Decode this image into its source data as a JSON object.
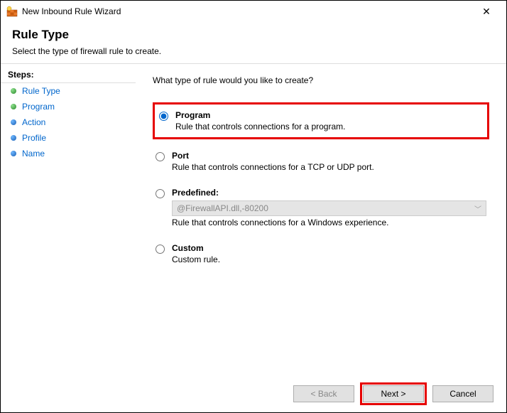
{
  "window": {
    "title": "New Inbound Rule Wizard"
  },
  "header": {
    "title": "Rule Type",
    "subtitle": "Select the type of firewall rule to create."
  },
  "sidebar": {
    "header": "Steps:",
    "items": [
      {
        "label": "Rule Type",
        "bullet": "green"
      },
      {
        "label": "Program",
        "bullet": "green"
      },
      {
        "label": "Action",
        "bullet": "blue"
      },
      {
        "label": "Profile",
        "bullet": "blue"
      },
      {
        "label": "Name",
        "bullet": "blue"
      }
    ]
  },
  "main": {
    "prompt": "What type of rule would you like to create?",
    "options": {
      "program": {
        "title": "Program",
        "desc": "Rule that controls connections for a program."
      },
      "port": {
        "title": "Port",
        "desc": "Rule that controls connections for a TCP or UDP port."
      },
      "predefined": {
        "title": "Predefined:",
        "select_value": "@FirewallAPI.dll,-80200",
        "desc": "Rule that controls connections for a Windows experience."
      },
      "custom": {
        "title": "Custom",
        "desc": "Custom rule."
      }
    }
  },
  "footer": {
    "back": "< Back",
    "next": "Next >",
    "cancel": "Cancel"
  }
}
